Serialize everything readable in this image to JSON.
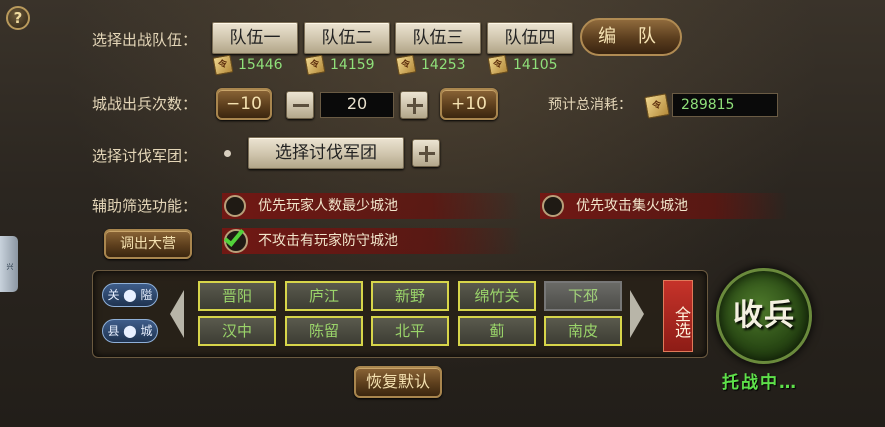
{
  "help_icon": "?",
  "side_tab": "兴",
  "teams": {
    "label": "选择出战队伍：",
    "buttons": [
      "队伍一",
      "队伍二",
      "队伍三",
      "队伍四"
    ],
    "counts": [
      "15446",
      "14159",
      "14253",
      "14105"
    ],
    "edit_label": "编 队"
  },
  "attack": {
    "label": "城战出兵次数：",
    "minus10": "−10",
    "value": "20",
    "plus10": "+10",
    "cost_label": "预计总消耗：",
    "cost_value": "289815"
  },
  "legion": {
    "label": "选择讨伐军团：",
    "button": "选择讨伐军团"
  },
  "filter": {
    "label": "辅助筛选功能：",
    "options": [
      {
        "text": "优先玩家人数最少城池",
        "checked": false
      },
      {
        "text": "优先攻击集火城池",
        "checked": false
      },
      {
        "text": "不攻击有玩家防守城池",
        "checked": true
      }
    ],
    "camp_button": "调出大营"
  },
  "city_types": [
    "关",
    "隘",
    "县",
    "城"
  ],
  "cities": {
    "row1": [
      "晋阳",
      "庐江",
      "新野",
      "绵竹关",
      "下邳"
    ],
    "row2": [
      "汉中",
      "陈留",
      "北平",
      "蓟",
      "南皮"
    ],
    "select_all": "全选"
  },
  "reset_label": "恢复默认",
  "collect_label": "收兵",
  "status": "托战中…",
  "colors": {
    "accent_green": "#5ee04a",
    "city_border": "#d7d54a",
    "select_all": "#c6332a"
  }
}
